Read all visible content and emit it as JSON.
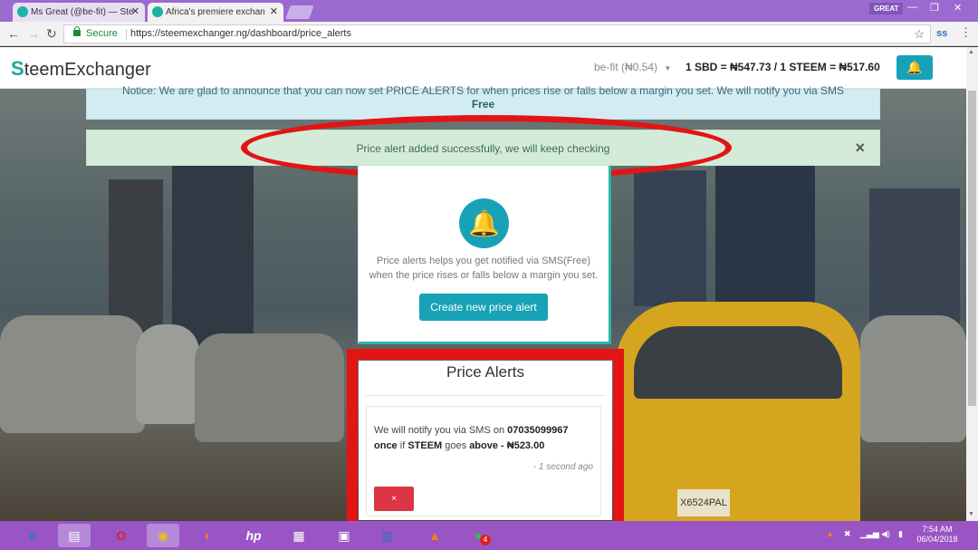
{
  "browser": {
    "tabs": [
      {
        "title": "Ms Great (@be-fit) — Ste"
      },
      {
        "title": "Africa's premiere exchan"
      }
    ],
    "profile_label": "GREAT",
    "secure_label": "Secure",
    "url": "https://steemexchanger.ng/dashboard/price_alerts"
  },
  "header": {
    "logo_initial": "S",
    "logo_rest": "teemExchanger",
    "user": "be-fit (₦0.54)",
    "rate": "1 SBD = ₦547.73 / 1 STEEM = ₦517.60"
  },
  "announcement": {
    "line1": "Notice: We are glad to announce that you can now set PRICE ALERTS for when prices rise or falls below a margin you set. We will notify you via SMS",
    "line2": "Free"
  },
  "success_alert": {
    "message": "Price alert added successfully, we will keep checking",
    "close": "×"
  },
  "info_card": {
    "description": "Price alerts helps you get notified via SMS(Free) when the price rises or falls below a margin you set.",
    "create_button": "Create new price alert"
  },
  "price_alerts": {
    "title": "Price Alerts",
    "items": [
      {
        "prefix": "We will notify you via SMS on ",
        "phone": "07035099967",
        "once": "once",
        "if": " if ",
        "coin": "STEEM",
        "goes": " goes ",
        "direction": "above - ₦523.00",
        "time": "- 1 second ago",
        "delete": "×"
      }
    ]
  },
  "taskbar": {
    "time": "7:54 AM",
    "date": "06/04/2018",
    "whatsapp_badge": "4"
  },
  "colors": {
    "brand_teal": "#17a2b8",
    "highlight_red": "#e31414",
    "success_bg": "#d4ebda",
    "info_bg": "#d2ecf2",
    "taskbar": "#9a55c4"
  }
}
